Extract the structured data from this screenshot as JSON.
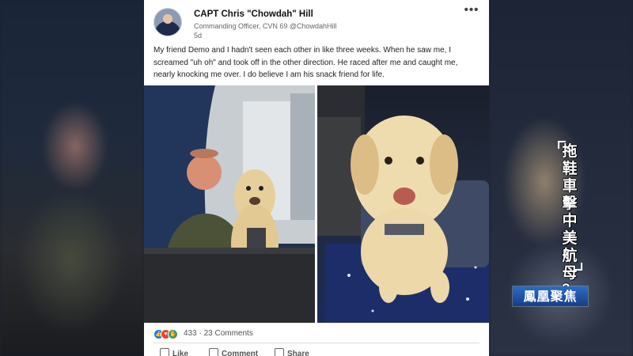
{
  "post": {
    "author_name": "CAPT Chris \"Chowdah\" Hill",
    "author_subtitle": "Commanding Officer, CVN 69 @ChowdahHill",
    "age": "5d",
    "more_label": "•••",
    "body_text": "My friend Demo and I hadn't seen each other in like three weeks. When he saw me, I screamed \"uh oh\" and took off in the other direction. He raced after me and caught me, nearly knocking me over. I do believe I am his snack friend for life.",
    "reactions_summary": "433 · 23 Comments"
  },
  "actions": {
    "like": "Like",
    "comment": "Comment",
    "share": "Share"
  },
  "overlay": {
    "vertical_title_chars": [
      "拖",
      "鞋",
      "車",
      "擊",
      "中",
      "美",
      "航",
      "母",
      "？"
    ],
    "channel_logo": "鳳凰聚焦"
  },
  "colors": {
    "like_blue": "#1877f2",
    "celebrate_red": "#e0463a",
    "support_green": "#4a9a5a",
    "logo_blue": "#1f5cb8"
  },
  "icons": [
    "avatar",
    "more-icon",
    "like-reaction-icon",
    "love-reaction-icon",
    "celebrate-reaction-icon",
    "like-icon",
    "comment-icon",
    "share-icon"
  ]
}
